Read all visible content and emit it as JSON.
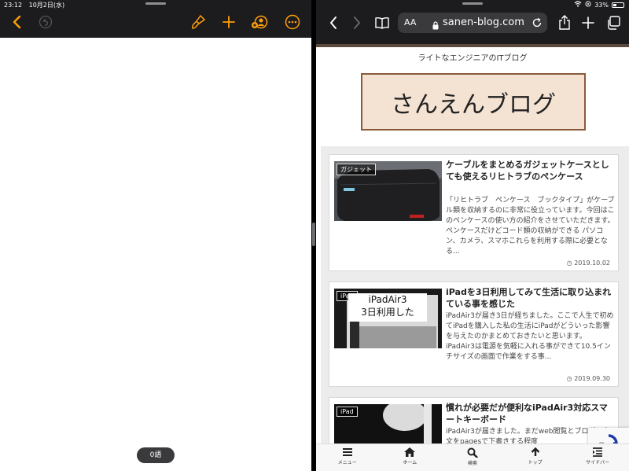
{
  "status": {
    "time": "23:12",
    "date": "10月2日(水)",
    "battery": "33%"
  },
  "pages": {
    "word_count": "0語"
  },
  "safari": {
    "text_size_label": "AA",
    "url": "sanen-blog.com"
  },
  "blog": {
    "tagline": "ライトなエンジニアのITブログ",
    "logo_text": "さんえんブログ",
    "posts": [
      {
        "category": "ガジェット",
        "title": "ケーブルをまとめるガジェットケースとしても使えるリヒトラブのペンケース",
        "excerpt": "「リヒトラブ　ペンケース　ブックタイプ」がケーブル類を収納するのに非常に役立っています。今回はこのペンケースの使い方の紹介をさせていただきます。 ペンケースだけどコード類の収納ができる パソコン、カメラ、スマホこれらを利用する際に必要となる...",
        "date": "2019.10.02"
      },
      {
        "category": "iPad",
        "thumb_text": [
          "iPadAir3",
          "3日利用した"
        ],
        "title": "iPadを3日利用してみて生活に取り込まれている事を感じた",
        "excerpt": "iPadAir3が届き3日が経ちました。ここで人生で初めてiPadを購入した私の生活にiPadがどういった影響を与えたのかまとめておきたいと思います。 iPadAir3は電源を気軽に入れる事ができて10.5インチサイズの画面で作業をする事...",
        "date": "2019.09.30"
      },
      {
        "category": "iPad",
        "title": "慣れが必要だが便利なiPadAir3対応スマートキーボード",
        "excerpt": "iPadAir3が届きました。まだweb閲覧とブログの本文をpagesで下書きする程度",
        "date": ""
      }
    ],
    "nav": [
      {
        "label": "メニュー",
        "icon": "menu-icon"
      },
      {
        "label": "ホーム",
        "icon": "home-icon"
      },
      {
        "label": "検索",
        "icon": "search-icon"
      },
      {
        "label": "トップ",
        "icon": "arrow-up-icon"
      },
      {
        "label": "サイドバー",
        "icon": "sidebar-icon"
      }
    ]
  },
  "colors": {
    "accent": "#ff9f0a",
    "brown": "#5b4a3b",
    "logo_bg": "#f4e3d3"
  }
}
